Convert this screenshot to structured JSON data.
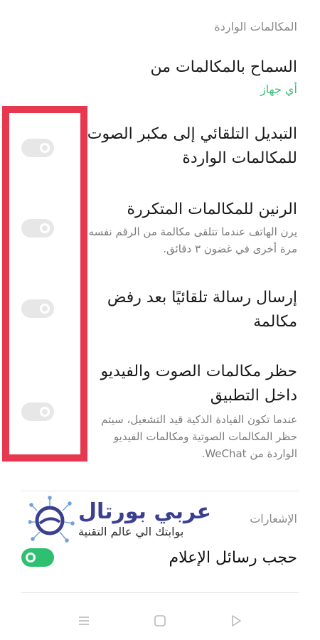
{
  "incoming_calls": {
    "header": "المكالمات الواردة",
    "allow_calls_from": {
      "title": "السماح بالمكالمات من",
      "value": "أي جهاز"
    },
    "auto_speaker": {
      "title_line1": "التبديل التلقائي إلى مكبر الصوت",
      "title_line2": "للمكالمات الواردة",
      "enabled": false
    },
    "repeated_calls": {
      "title": "الرنين للمكالمات المتكررة",
      "desc_line1": "يرن الهاتف عندما تتلقى مكالمة من الرقم نفسه",
      "desc_line2": "مرة أخرى في غضون ٣ دقائق.",
      "enabled": false
    },
    "auto_message": {
      "title_line1": "إرسال رسالة تلقائيًا بعد رفض",
      "title_line2": "مكالمة",
      "enabled": false
    },
    "block_app_calls": {
      "title_line1": "حظر مكالمات الصوت والفيديو",
      "title_line2": "داخل التطبيق",
      "desc_line1": "عندما تكون القيادة الذكية قيد التشغيل، سيتم",
      "desc_line2": "حظر المكالمات الصوتية ومكالمات الفيديو",
      "desc_line3": "الواردة من WeChat.",
      "enabled": false
    }
  },
  "notifications": {
    "header": "الإشعارات",
    "block_media": {
      "title": "حجب رسائل الإعلام",
      "enabled": true
    }
  },
  "watermark": {
    "main": "عربي بورتال",
    "sub": "بوابتك الي عالم التقنية"
  },
  "colors": {
    "accent_green": "#2fbf71",
    "highlight_red": "#e8384f",
    "brand_blue": "#3a3f8f"
  },
  "navbar": {
    "icons": [
      "menu-icon",
      "home-square-icon",
      "back-triangle-icon"
    ]
  }
}
